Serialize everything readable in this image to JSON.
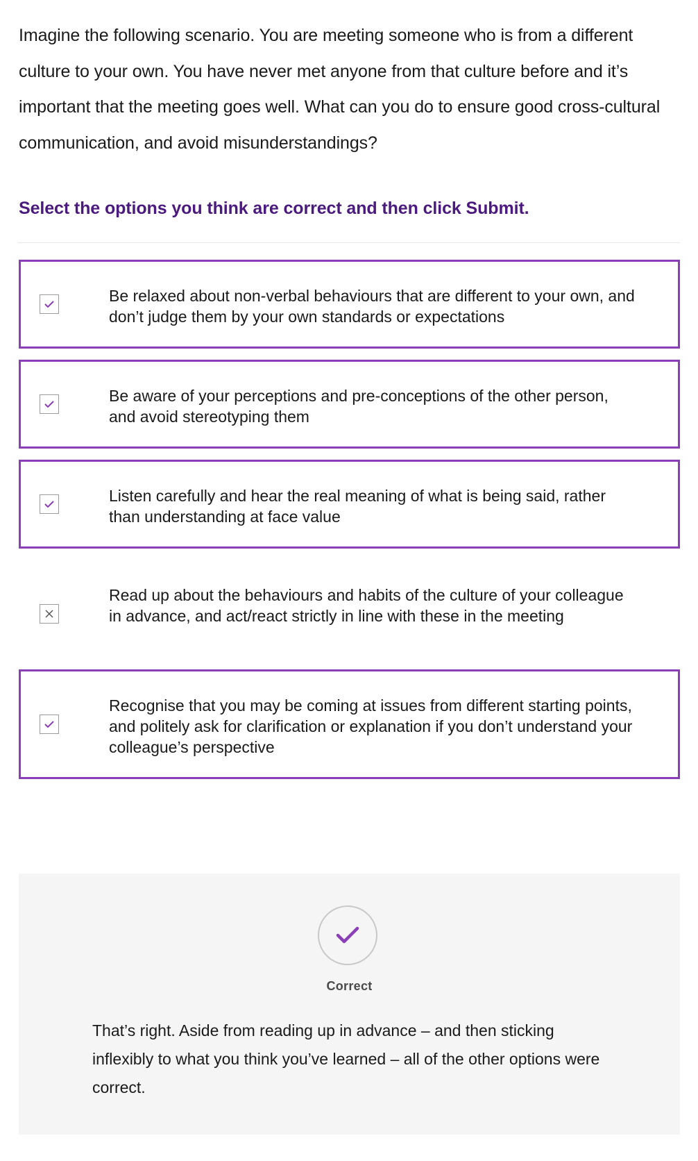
{
  "intro": {
    "text": "Imagine the following scenario. You are meeting someone who is from a different culture to your own. You have never met anyone from that culture before and it’s important that the meeting goes well. What can you do to ensure good cross-cultural communication, and avoid misunderstandings?"
  },
  "instruction": {
    "text": "Select the options you think are correct and then click Submit."
  },
  "options": [
    {
      "label": "Be relaxed about non-verbal behaviours that are different to your own, and don’t judge them by your own standards or expectations",
      "selected": true,
      "mark": "check-icon"
    },
    {
      "label": "Be aware of your perceptions and pre-conceptions of the other person, and avoid stereotyping them",
      "selected": true,
      "mark": "check-icon"
    },
    {
      "label": "Listen carefully and hear the real meaning of what is being said, rather than understanding at face value",
      "selected": true,
      "mark": "check-icon"
    },
    {
      "label": "Read up about the behaviours and habits of the culture of your colleague in advance, and act/react strictly in line with these in the meeting",
      "selected": false,
      "mark": "cross-icon"
    },
    {
      "label": "Recognise that you may be coming at issues from different starting points, and politely ask for clarification or explanation if you don’t understand your colleague’s perspective",
      "selected": true,
      "mark": "check-icon"
    }
  ],
  "feedback": {
    "icon": "check-circle-icon",
    "label": "Correct",
    "text": "That’s right. Aside from reading up in advance – and then sticking inflexibly to what you think you’ve learned – all of the other options were correct."
  },
  "colors": {
    "accent": "#8a3eb8",
    "instruction": "#4b1a7e",
    "feedback_background": "#f5f5f5"
  }
}
